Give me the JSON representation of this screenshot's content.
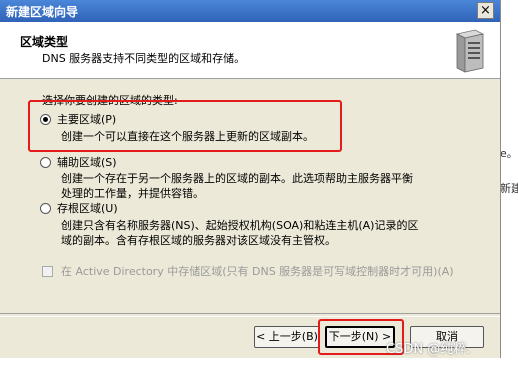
{
  "window": {
    "title": "新建区域向导",
    "close_label": "×"
  },
  "header": {
    "title": "区域类型",
    "subtitle": "DNS 服务器支持不同类型的区域和存储。"
  },
  "section_label": "选择你要创建的区域的类型:",
  "options": [
    {
      "label": "主要区域(P)",
      "checked": true,
      "desc": [
        "创建一个可以直接在这个服务器上更新的区域副本。"
      ]
    },
    {
      "label": "辅助区域(S)",
      "checked": false,
      "desc": [
        "创建一个存在于另一个服务器上的区域的副本。此选项帮助主服务器平衡",
        "处理的工作量，并提供容错。"
      ]
    },
    {
      "label": "存根区域(U)",
      "checked": false,
      "desc": [
        "创建只含有名称服务器(NS)、起始授权机构(SOA)和粘连主机(A)记录的区",
        "域的副本。含有存根区域的服务器对该区域没有主管权。"
      ]
    }
  ],
  "ad_checkbox": {
    "label": "在 Active Directory 中存储区域(只有 DNS 服务器是可写域控制器时才可用)(A)",
    "checked": false,
    "enabled": false
  },
  "buttons": {
    "back": "< 上一步(B)",
    "next": "下一步(N) >",
    "cancel": "取消"
  },
  "background_text": {
    "line1": "e。 a",
    "line2": "新建"
  },
  "watermark": "CSDN @纯粹.",
  "colors": {
    "highlight": "#e31b1b",
    "titlebar": "#2f63b8",
    "dialog_bg": "#ece9d8"
  }
}
